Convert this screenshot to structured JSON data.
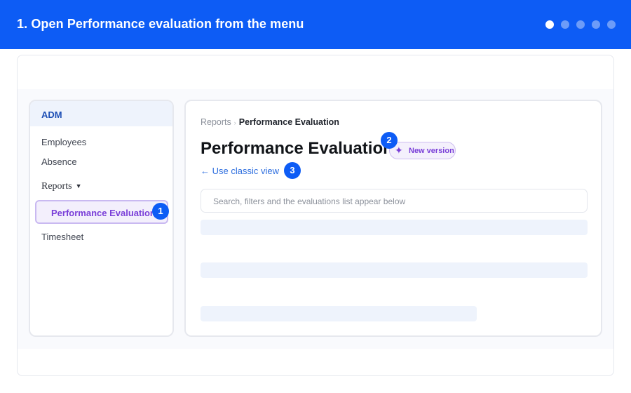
{
  "header": {
    "step_title": "1. Open Performance evaluation from the menu",
    "steps_total": 5,
    "current_step": 1,
    "background_color": "#0d5cf5"
  },
  "sidebar": {
    "section_title": "ADM",
    "items": [
      {
        "label": "Employees"
      },
      {
        "label": "Absence"
      },
      {
        "label": "Reports",
        "caret": "▼"
      },
      {
        "label": "Performance Evaluation",
        "active": true
      },
      {
        "label": "Timesheet"
      }
    ]
  },
  "main": {
    "breadcrumb": {
      "parent": "Reports",
      "separator": "›",
      "current": "Performance Evaluation"
    },
    "title": "Performance Evaluation",
    "new_badge": {
      "icon": "sparkle-icon",
      "glyph": "✦",
      "label": "New version"
    },
    "classic_link": "← Use classic view",
    "search_placeholder": "Search, filters and the evaluations list appear below"
  },
  "markers": [
    "1",
    "2",
    "3"
  ],
  "colors": {
    "accent": "#0d5cf5",
    "purple": "#7a3fd8",
    "link": "#2f6fdf"
  }
}
